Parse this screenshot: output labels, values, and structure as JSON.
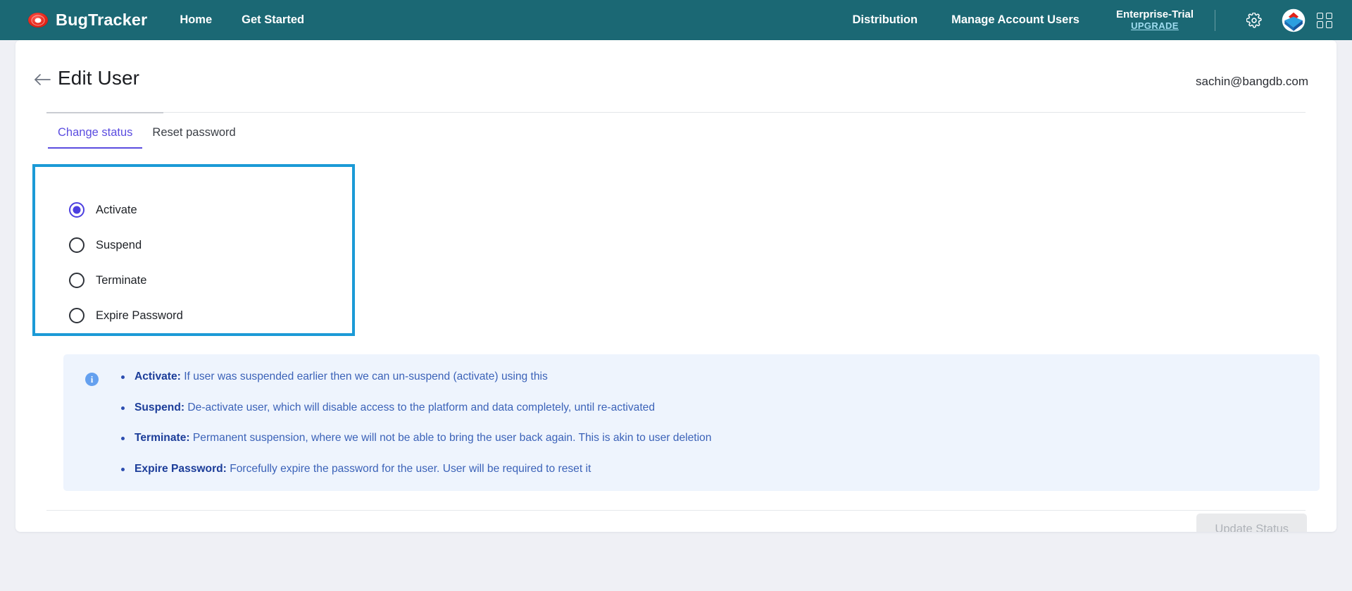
{
  "topnav": {
    "brand": "BugTracker",
    "brand_logo_icon": "bug-logo-icon",
    "left_links": [
      "Home",
      "Get Started"
    ],
    "right_links": [
      "Distribution",
      "Manage Account Users"
    ],
    "plan_name": "Enterprise-Trial",
    "plan_upgrade": "UPGRADE",
    "gear_icon": "gear-icon",
    "app_logo_icon": "bangdb-logo-icon",
    "apps_icon": "apps-grid-icon",
    "background_color": "#1b6874"
  },
  "page": {
    "back_icon": "back-arrow-icon",
    "title": "Edit User",
    "user_email": "sachin@bangdb.com"
  },
  "tabs": [
    {
      "label": "Change status",
      "active": true
    },
    {
      "label": "Reset password",
      "active": false
    }
  ],
  "status_options": [
    {
      "label": "Activate",
      "selected": true
    },
    {
      "label": "Suspend",
      "selected": false
    },
    {
      "label": "Terminate",
      "selected": false
    },
    {
      "label": "Expire Password",
      "selected": false
    }
  ],
  "highlight_color": "#1b9ad6",
  "accent_color": "#5b4de0",
  "info": {
    "icon": "info-circle-icon",
    "icon_glyph": "i",
    "items": [
      {
        "term": "Activate:",
        "text": " If user was suspended earlier then we can un-suspend (activate) using this"
      },
      {
        "term": "Suspend:",
        "text": " De-activate user, which will disable access to the platform and data completely, until re-activated"
      },
      {
        "term": "Terminate:",
        "text": " Permanent suspension, where we will not be able to bring the user back again. This is akin to user deletion"
      },
      {
        "term": "Expire Password:",
        "text": " Forcefully expire the password for the user. User will be required to reset it"
      }
    ]
  },
  "footer": {
    "update_button": "Update Status",
    "update_button_disabled": true
  }
}
